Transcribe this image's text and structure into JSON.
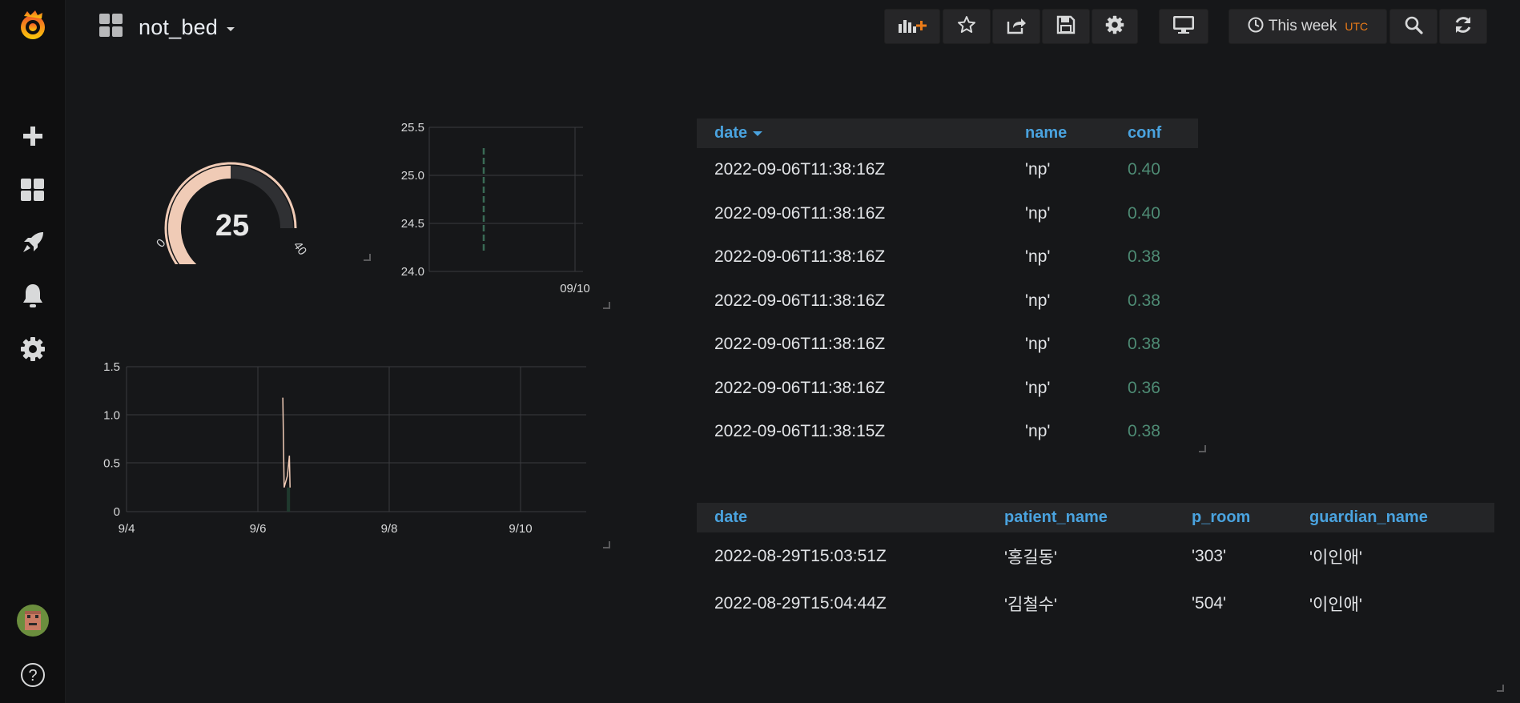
{
  "dashboard": {
    "title": "not_bed"
  },
  "toolbar": {
    "time_range_label": "This week",
    "timezone_badge": "UTC"
  },
  "gauge": {
    "value": "25",
    "min_label": "0",
    "max_label": "40",
    "value_fraction": 0.625
  },
  "sparkline": {
    "y_ticks": [
      "25.5",
      "25.0",
      "24.5",
      "24.0"
    ],
    "x_ticks": [
      "09/10"
    ]
  },
  "chart_data": [
    {
      "type": "gauge",
      "value": 25,
      "min": 0,
      "max": 40,
      "thresholds_colors": [
        "#f0cbb6"
      ]
    },
    {
      "type": "line",
      "ylim": [
        24.0,
        25.5
      ],
      "yticks": [
        24.0,
        24.5,
        25.0,
        25.5
      ],
      "xticks": [
        "09/10"
      ],
      "series": [
        {
          "x": [
            "9/6"
          ],
          "y_min": 24.2,
          "y_max": 25.3,
          "style": "dashed",
          "color": "#3a6a55"
        }
      ],
      "grid": true
    },
    {
      "type": "line",
      "ylim": [
        0,
        1.5
      ],
      "yticks": [
        0,
        0.5,
        1.0,
        1.5
      ],
      "xticks": [
        "9/4",
        "9/6",
        "9/8",
        "9/10"
      ],
      "series": [
        {
          "color": "#f0cbb6",
          "points": [
            {
              "x": 6.38,
              "y": 1.18
            },
            {
              "x": 6.4,
              "y": 0.25
            },
            {
              "x": 6.45,
              "y": 0.37
            },
            {
              "x": 6.48,
              "y": 0.58
            },
            {
              "x": 6.49,
              "y": 0.25
            }
          ]
        },
        {
          "color": "#1f3a2e",
          "fill": true,
          "points": [
            {
              "x": 6.44,
              "y": 0.25
            },
            {
              "x": 6.49,
              "y": 0.25
            }
          ]
        }
      ],
      "grid": true
    }
  ],
  "table_detections": {
    "columns": [
      "date",
      "name",
      "conf"
    ],
    "sort_indicator": "date",
    "rows": [
      [
        "2022-09-06T11:38:16Z",
        "'np'",
        "0.40"
      ],
      [
        "2022-09-06T11:38:16Z",
        "'np'",
        "0.40"
      ],
      [
        "2022-09-06T11:38:16Z",
        "'np'",
        "0.38"
      ],
      [
        "2022-09-06T11:38:16Z",
        "'np'",
        "0.38"
      ],
      [
        "2022-09-06T11:38:16Z",
        "'np'",
        "0.38"
      ],
      [
        "2022-09-06T11:38:16Z",
        "'np'",
        "0.36"
      ],
      [
        "2022-09-06T11:38:15Z",
        "'np'",
        "0.38"
      ]
    ]
  },
  "table_patients": {
    "columns": [
      "date",
      "patient_name",
      "p_room",
      "guardian_name"
    ],
    "rows": [
      [
        "2022-08-29T15:03:51Z",
        "'홍길동'",
        "'303'",
        "'이인애'"
      ],
      [
        "2022-08-29T15:04:44Z",
        "'김철수'",
        "'504'",
        "'이인애'"
      ]
    ]
  },
  "colors": {
    "accent": "#4aa3df",
    "gauge_fill": "#f0cbb6",
    "conf_text": "#4e8b74",
    "brand": "#f05a28"
  },
  "icons": {
    "sidebar": [
      "grafana-logo-icon",
      "plus-icon",
      "dashboards-grid-icon",
      "rocket-icon",
      "bell-icon",
      "gear-icon",
      "user-avatar",
      "help-icon"
    ],
    "navbar": [
      "dashboard-grid-icon",
      "add-panel-icon",
      "star-icon",
      "share-icon",
      "save-icon",
      "settings-gear-icon",
      "tv-monitor-icon",
      "clock-icon",
      "zoom-out-icon",
      "refresh-icon"
    ]
  }
}
